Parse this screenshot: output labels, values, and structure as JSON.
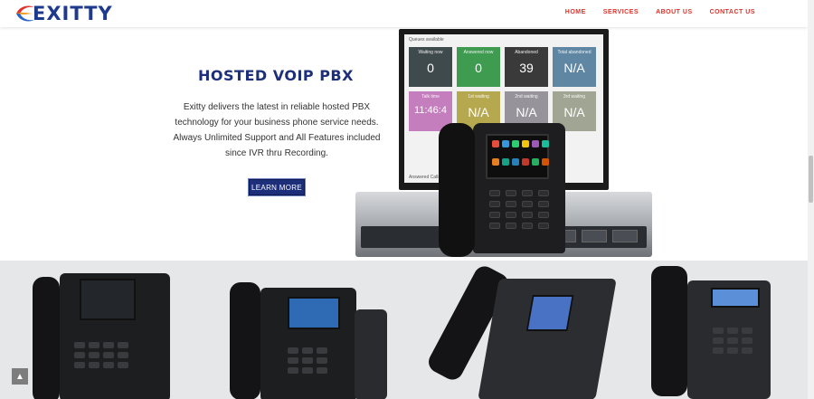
{
  "header": {
    "logo_text": "EXITTY",
    "nav": [
      {
        "label": "HOME"
      },
      {
        "label": "SERVICES"
      },
      {
        "label": "ABOUT US"
      },
      {
        "label": "CONTACT US"
      }
    ]
  },
  "hero": {
    "title": "HOSTED VOIP PBX",
    "body": "Exitty delivers the latest in reliable hosted PBX technology for your business phone service needs. Always Unlimited Support and All Features included since IVR thru Recording.",
    "cta_label": "LEARN MORE"
  },
  "dashboard": {
    "header": "Queues available",
    "footer": "Answered Calls",
    "tiles": [
      {
        "label": "Waiting now",
        "value": "0",
        "color": "#3f4a4d"
      },
      {
        "label": "Answered now",
        "value": "0",
        "color": "#3e9b4f"
      },
      {
        "label": "Abandoned",
        "value": "39",
        "color": "#3a3a3a"
      },
      {
        "label": "Total abandoned",
        "value": "N/A",
        "color": "#5f86a3"
      },
      {
        "label": "Talk time",
        "value": "11:46:4",
        "color": "#c57ebd"
      },
      {
        "label": "1st waiting",
        "value": "N/A",
        "color": "#b5a84f"
      },
      {
        "label": "2nd waiting",
        "value": "N/A",
        "color": "#96949a"
      },
      {
        "label": "3rd waiting",
        "value": "N/A",
        "color": "#a0a693"
      }
    ]
  },
  "colors": {
    "brand_blue": "#1d2f7a",
    "nav_red": "#e0302a",
    "band_gray": "#e6e7e8"
  },
  "icons": {
    "scroll_top": "chevron-up-icon"
  }
}
